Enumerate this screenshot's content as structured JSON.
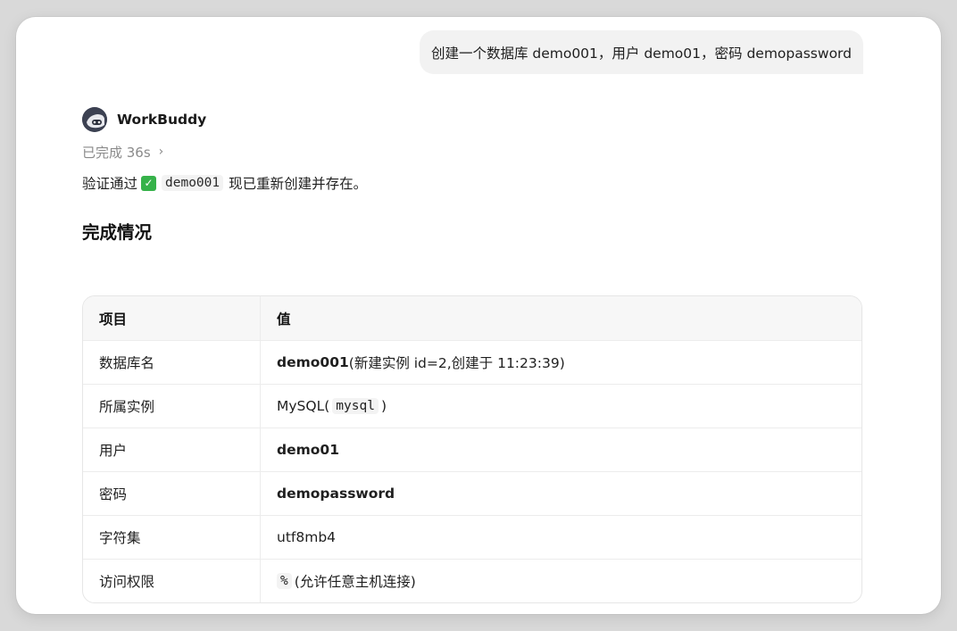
{
  "user_message": "创建一个数据库 demo001，用户 demo01，密码 demopassword",
  "agent": {
    "name": "WorkBuddy",
    "avatar_icon": "robot-avatar-icon",
    "status": "已完成 36s",
    "status_chevron": "›",
    "result": {
      "prefix": "验证通过",
      "check_icon": "✓",
      "code": "demo001",
      "suffix": "现已重新创建并存在。"
    },
    "section_title": "完成情况"
  },
  "table": {
    "headers": {
      "key": "项目",
      "value": "值"
    },
    "rows": [
      {
        "key": "数据库名",
        "value_bold": "demo001",
        "value_rest": "(新建实例 id=2,创建于 11:23:39)"
      },
      {
        "key": "所属实例",
        "value_pre": "MySQL(",
        "value_code": "mysql",
        "value_post": ")"
      },
      {
        "key": "用户",
        "value_bold": "demo01"
      },
      {
        "key": "密码",
        "value_bold": "demopassword"
      },
      {
        "key": "字符集",
        "value_plain": "utf8mb4"
      },
      {
        "key": "访问权限",
        "value_code": "%",
        "value_post": "(允许任意主机连接)"
      }
    ]
  },
  "colors": {
    "check_green": "#36b24a",
    "bubble_bg": "#f2f2f2",
    "avatar_bg": "#3c4152"
  }
}
